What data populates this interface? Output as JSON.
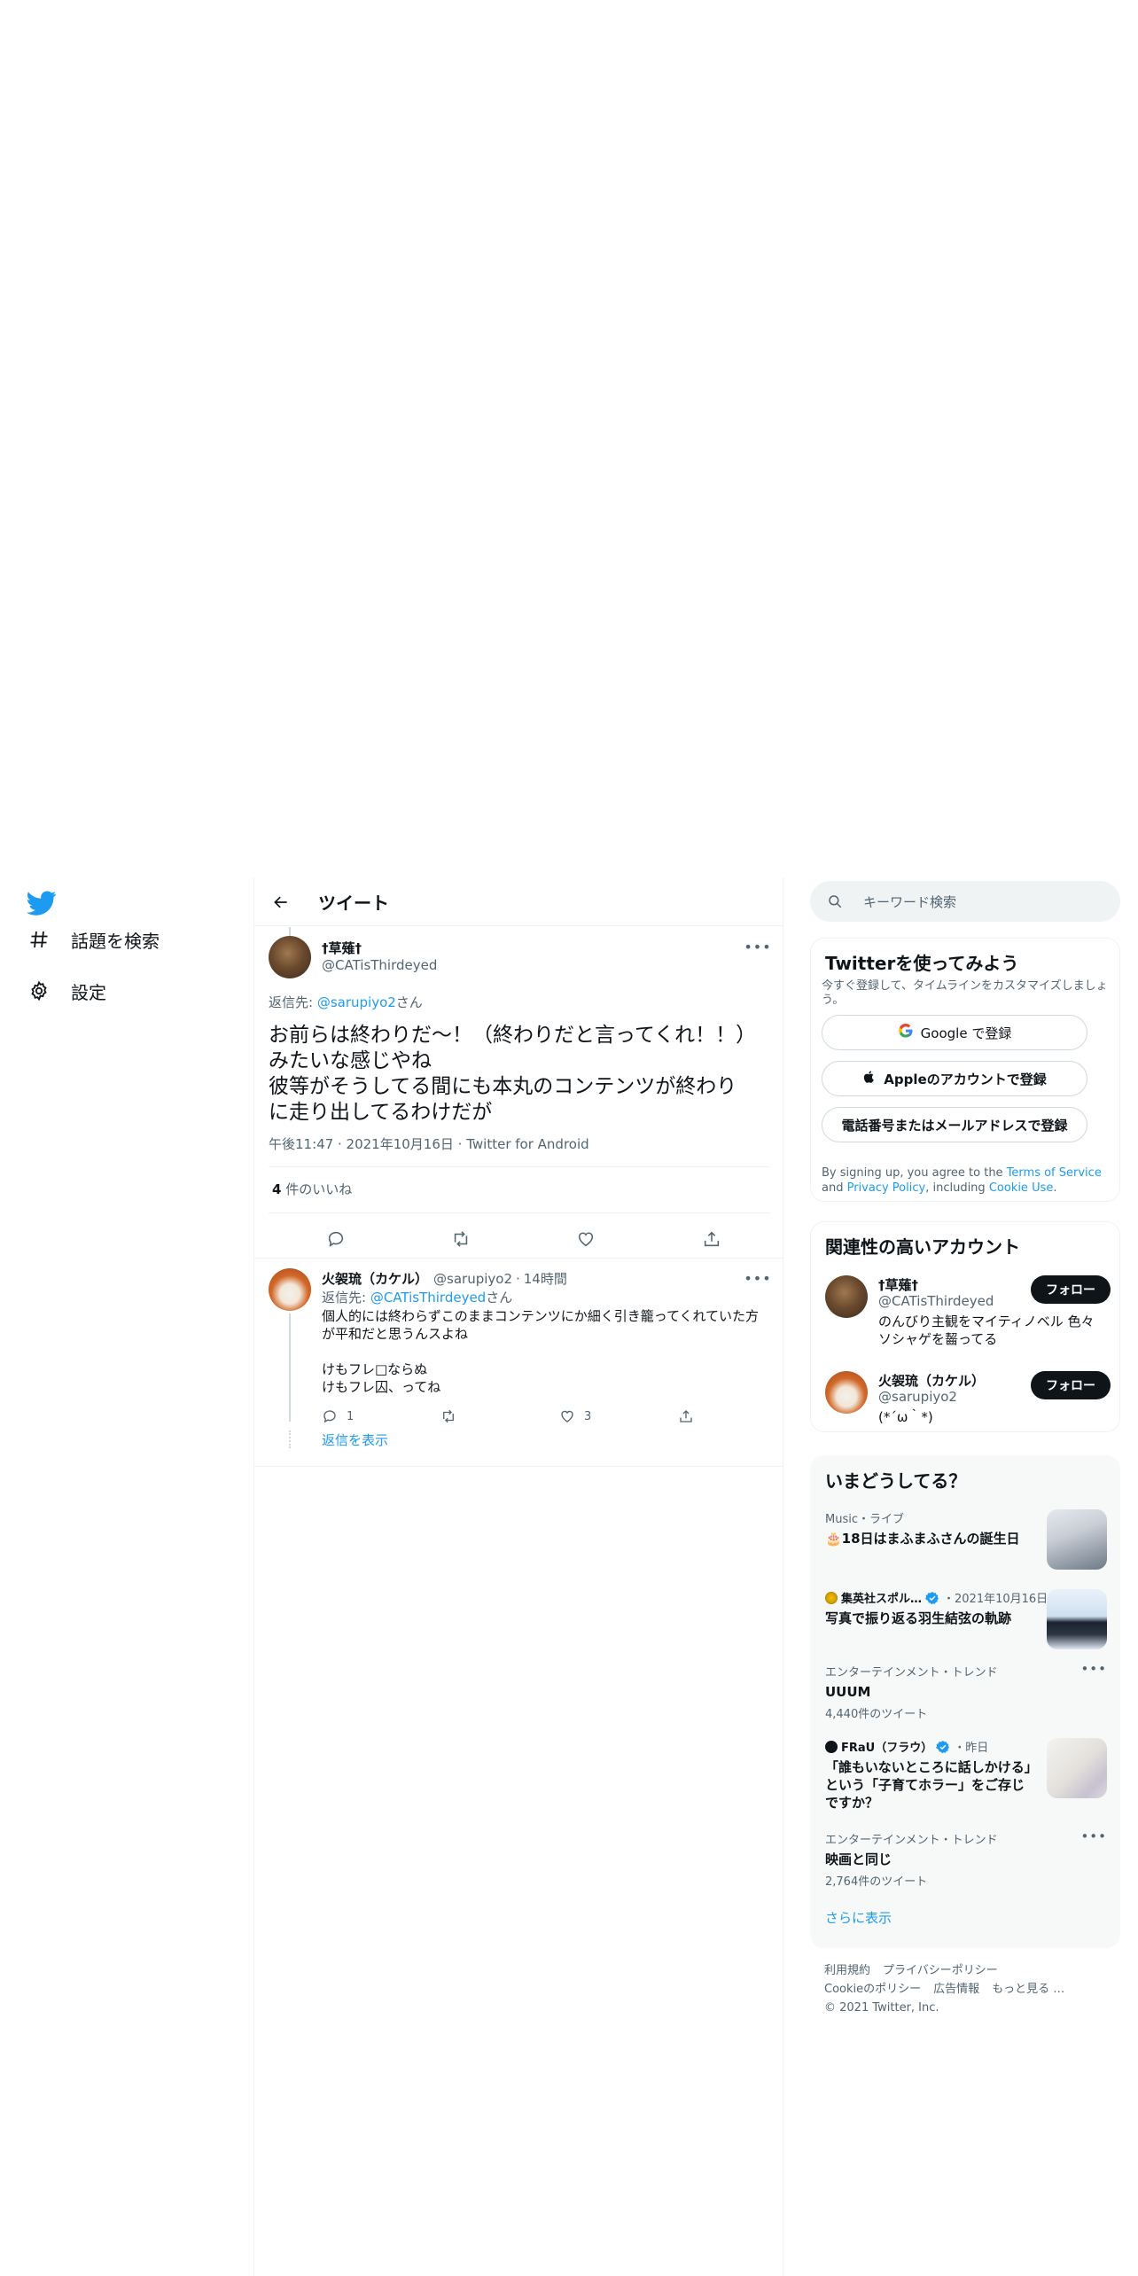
{
  "header": {
    "title": "ツイート"
  },
  "nav": {
    "items": [
      {
        "label": "話題を検索",
        "icon": "hashtag-icon"
      },
      {
        "label": "設定",
        "icon": "gear-icon"
      }
    ]
  },
  "tweet": {
    "display_name": "†草薙†",
    "handle": "@CATisThirdeyed",
    "reply_to_prefix": "返信先: ",
    "reply_to_handle": "@sarupiyo2",
    "reply_to_suffix": "さん",
    "text": "お前らは終わりだ～！（終わりだと言ってくれ！！）\nみたいな感じやね\n彼等がそうしてる間にも本丸のコンテンツが終わり\nに走り出してるわけだが",
    "time": "午後11:47",
    "date": "2021年10月16日",
    "client": "Twitter for Android",
    "likes_count": "4",
    "likes_label": " 件のいいね"
  },
  "reply": {
    "display_name": "火袈琉（カケル）",
    "handle": "@sarupiyo2",
    "time": "14時間",
    "reply_to_prefix": "返信先: ",
    "reply_to_handle": "@CATisThirdeyed",
    "reply_to_suffix": "さん",
    "text": "個人的には終わらずこのままコンテンツにか細く引き籠ってくれていた方\nが平和だと思うんスよね\n\nけもフレ□ならぬ\nけもフレ囚、ってね",
    "reply_count": "1",
    "like_count": "3",
    "show_replies": "返信を表示"
  },
  "search": {
    "placeholder": "キーワード検索"
  },
  "signup": {
    "title": "Twitterを使ってみよう",
    "subtitle": "今すぐ登録して、タイムラインをカスタマイズしましょう。",
    "google_label": "Google で登録",
    "apple_label": "Appleのアカウントで登録",
    "phone_label": "電話番号またはメールアドレスで登録",
    "legal_1": "By signing up, you agree to the ",
    "terms": "Terms of Service",
    "legal_2": " and ",
    "privacy": "Privacy Policy",
    "legal_3": ", including ",
    "cookie": "Cookie Use",
    "legal_4": "."
  },
  "related": {
    "title": "関連性の高いアカウント",
    "follow_label": "フォロー",
    "accounts": [
      {
        "name": "†草薙†",
        "handle": "@CATisThirdeyed",
        "bio": "のんびり主観をマイティノベル 色々ソシャゲを齧ってる"
      },
      {
        "name": "火袈琉（カケル）",
        "handle": "@sarupiyo2",
        "bio": "(*´ω｀*)"
      }
    ]
  },
  "trends": {
    "title": "いまどうしてる？",
    "items": [
      {
        "meta": "Music・ライブ",
        "title": "🎂18日はまふまふさんの誕生日"
      },
      {
        "source": "集英社スポル…",
        "meta": "・2021年10月16日",
        "title": "写真で振り返る羽生結弦の軌跡"
      },
      {
        "meta": "エンターテインメント・トレンド",
        "title": "UUUM",
        "count": "4,440件のツイート"
      },
      {
        "source": "FRaU（フラウ）",
        "meta": "・昨日",
        "title": "「誰もいないところに話しかける」という「子育てホラー」をご存じですか？"
      },
      {
        "meta": "エンターテインメント・トレンド",
        "title": "映画と同じ",
        "count": "2,764件のツイート"
      }
    ],
    "show_more": "さらに表示"
  },
  "footer": {
    "links": [
      "利用規約",
      "プライバシーポリシー",
      "Cookieのポリシー",
      "広告情報",
      "もっと見る …"
    ],
    "copyright": "© 2021 Twitter, Inc."
  },
  "colors": {
    "accent": "#1d9bf0",
    "text": "#0f1419",
    "muted": "#536471",
    "border": "#eff3f4"
  }
}
